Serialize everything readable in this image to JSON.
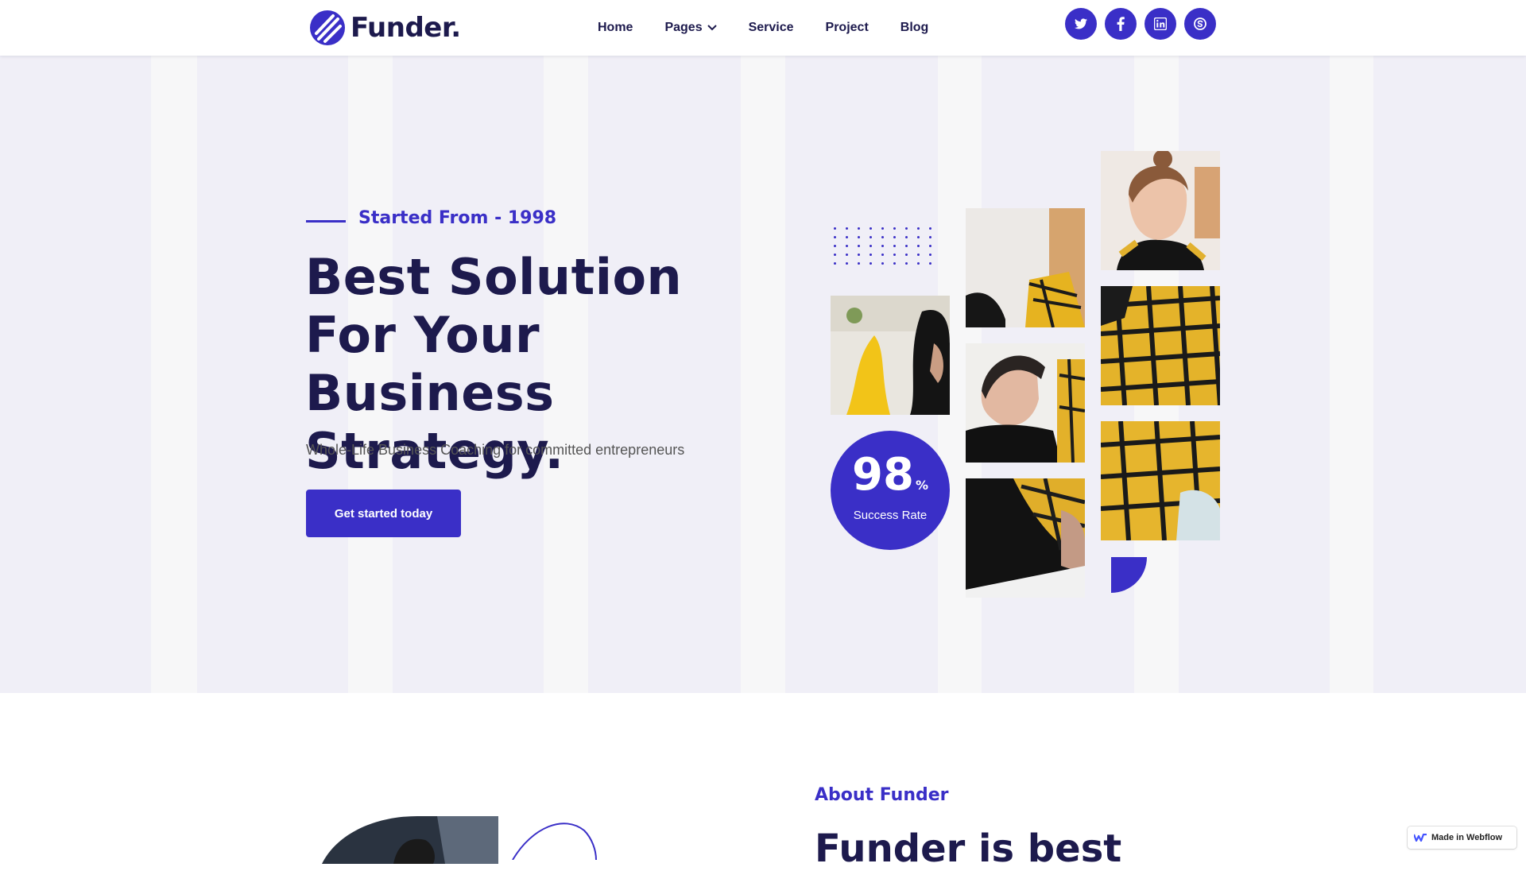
{
  "brand": {
    "name": "Funder.",
    "accent": "#3a2fc7",
    "dark": "#1d1a4d"
  },
  "nav": {
    "items": [
      {
        "label": "Home"
      },
      {
        "label": "Pages",
        "has_dropdown": true
      },
      {
        "label": "Service"
      },
      {
        "label": "Project"
      },
      {
        "label": "Blog"
      }
    ],
    "social": [
      "twitter-icon",
      "facebook-icon",
      "linkedin-icon",
      "skype-icon"
    ]
  },
  "hero": {
    "eyebrow": "Started From - 1998",
    "title": "Best Solution For Your Business Strategy.",
    "subtitle": "Whole-Life Business Coaching for committed entrepreneurs",
    "cta_label": "Get started today",
    "stat": {
      "value": "98",
      "unit": "%",
      "label": "Success Rate"
    }
  },
  "about": {
    "label": "About Funder",
    "title": "Funder is best"
  },
  "badge": {
    "label": "Made in Webflow"
  }
}
